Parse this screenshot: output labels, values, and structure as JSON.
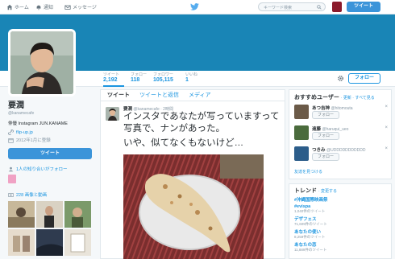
{
  "nav": {
    "home": "ホーム",
    "notifications": "通知",
    "messages": "メッセージ",
    "search_placeholder": "キーワード検索",
    "tweet_button": "ツイート"
  },
  "profile_nav": {
    "stats": [
      {
        "label": "ツイート",
        "value": "2,192"
      },
      {
        "label": "フォロー",
        "value": "118"
      },
      {
        "label": "フォロワー",
        "value": "105,115"
      },
      {
        "label": "いいね",
        "value": "1"
      }
    ],
    "follow_button": "フォロー"
  },
  "profile": {
    "name": "要潤",
    "handle": "@kanamecafe",
    "bio": "俳優 Instagram JUN.KANAME",
    "link": "flip-up.jp",
    "joined": "2012年1月に登録",
    "tweet_button": "ツイート",
    "mutual_followers": "1人の知り合いがフォロー",
    "media_title": "228 画像と動画"
  },
  "timeline": {
    "tabs": [
      "ツイート",
      "ツイートと返信",
      "メディア"
    ],
    "tweet": {
      "author": "要潤",
      "handle": "@kanamecafe",
      "time": "· 2時間",
      "text": "インスタであなたが写っていますって写真で、ナンがあった。",
      "text2": "いや、似てなくもないけど…"
    }
  },
  "who_to_follow": {
    "title": "おすすめユーザー",
    "links": "· 更新 · すべて見る",
    "users": [
      {
        "name": "あつ吉神",
        "handle": "@hitomouta",
        "follow": "フォロー",
        "avatar_color": "#6b5a48"
      },
      {
        "name": "遠藤",
        "handle": "@haruqui_ueo",
        "follow": "フォロー",
        "avatar_color": "#4a6b3c"
      },
      {
        "name": "つきみ",
        "handle": "@UDDDDDDDDDDD",
        "follow": "フォロー",
        "avatar_color": "#2c5d8a"
      }
    ],
    "find_more": "友達を見つける"
  },
  "trends": {
    "title": "トレンド",
    "change": "· 変更する",
    "items": [
      {
        "name": "#沖縄国際映画祭",
        "count": ""
      },
      {
        "name": "#evispa",
        "count": "1,040件のツイート"
      },
      {
        "name": "デザフェス",
        "count": "71,609件のツイート"
      },
      {
        "name": "あなたの使い",
        "count": "8,259件のツイート"
      },
      {
        "name": "あなたの恋",
        "count": "11,889件のツイート"
      }
    ]
  },
  "colors": {
    "accent": "#1b95e0",
    "banner": "#1985b6",
    "button": "#3b94d9"
  }
}
